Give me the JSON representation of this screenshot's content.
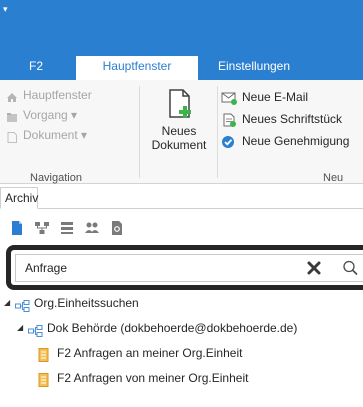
{
  "quick_access": {
    "menu_icon": "dropdown-arrow-icon"
  },
  "ribbon_tabs": [
    {
      "label": "F2"
    },
    {
      "label": "Hauptfenster"
    },
    {
      "label": "Einstellungen"
    }
  ],
  "navigation_group": {
    "label": "Navigation",
    "items": [
      {
        "label": "Hauptfenster",
        "icon": "home-icon"
      },
      {
        "label": "Vorgang ▾",
        "icon": "folder-icon"
      },
      {
        "label": "Dokument ▾",
        "icon": "document-icon"
      }
    ]
  },
  "new_document": {
    "line1": "Neues",
    "line2": "Dokument",
    "icon": "new-document-icon"
  },
  "new_group": {
    "label": "Neu",
    "items": [
      {
        "label": "Neue E-Mail",
        "icon": "email-icon"
      },
      {
        "label": "Neues Schriftstück",
        "icon": "document-add-icon"
      },
      {
        "label": "Neue Genehmigung",
        "icon": "approval-icon"
      }
    ]
  },
  "archive_tab": {
    "label": "Archiv"
  },
  "search": {
    "value": "Anfrage",
    "placeholder": ""
  },
  "tree": {
    "root": {
      "label": "Org.Einheitssuchen"
    },
    "child": {
      "label": "Dok Behörde (dokbehoerde@dokbehoerde.de)"
    },
    "leaves": [
      {
        "label": "F2 Anfragen an meiner Org.Einheit"
      },
      {
        "label": "F2 Anfragen von meiner Org.Einheit"
      }
    ]
  },
  "colors": {
    "accent": "#2b7fd1",
    "highlight_border": "#262626",
    "leaf_icon": "#f0b429"
  }
}
